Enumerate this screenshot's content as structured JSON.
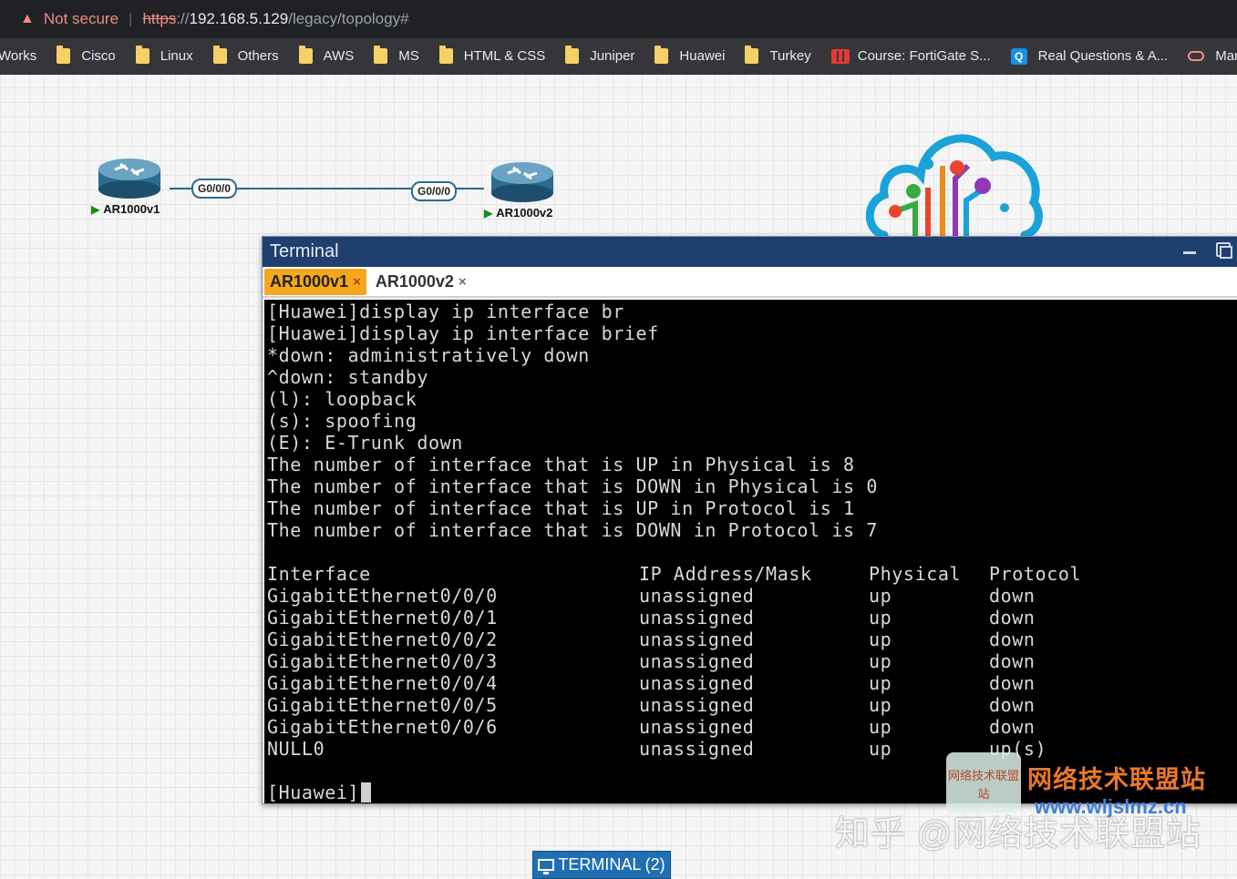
{
  "browser": {
    "security_text": "Not secure",
    "url_scheme": "https",
    "url_sep": "://",
    "url_host": "192.168.5.129",
    "url_path": "/legacy/topology#",
    "bookmarks": [
      {
        "label": "Works",
        "icon": "folder-icon"
      },
      {
        "label": "Cisco",
        "icon": "folder-icon"
      },
      {
        "label": "Linux",
        "icon": "folder-icon"
      },
      {
        "label": "Others",
        "icon": "folder-icon"
      },
      {
        "label": "AWS",
        "icon": "folder-icon"
      },
      {
        "label": "MS",
        "icon": "folder-icon"
      },
      {
        "label": "HTML & CSS",
        "icon": "folder-icon"
      },
      {
        "label": "Juniper",
        "icon": "folder-icon"
      },
      {
        "label": "Huawei",
        "icon": "folder-icon"
      },
      {
        "label": "Turkey",
        "icon": "folder-icon"
      },
      {
        "label": "Course: FortiGate S...",
        "icon": "fortinet-icon"
      },
      {
        "label": "Real Questions & A...",
        "icon": "q-app-icon"
      },
      {
        "label": "Manag",
        "icon": "manage-icon"
      }
    ]
  },
  "topology": {
    "router1": {
      "name": "AR1000v1",
      "port": "G0/0/0"
    },
    "router2": {
      "name": "AR1000v2",
      "port": "G0/0/0"
    },
    "link_color": "#2c6a8f"
  },
  "terminal": {
    "title": "Terminal",
    "tabs": [
      {
        "label": "AR1000v1",
        "active": true
      },
      {
        "label": "AR1000v2",
        "active": false
      }
    ],
    "close_glyph": "×",
    "lines": [
      "[Huawei]display ip interface br",
      "[Huawei]display ip interface brief",
      "*down: administratively down",
      "^down: standby",
      "(l): loopback",
      "(s): spoofing",
      "(E): E-Trunk down",
      "The number of interface that is UP in Physical is 8",
      "The number of interface that is DOWN in Physical is 0",
      "The number of interface that is UP in Protocol is 1",
      "The number of interface that is DOWN in Protocol is 7"
    ],
    "table_header": [
      "Interface",
      "IP Address/Mask",
      "Physical",
      "Protocol"
    ],
    "table_rows": [
      [
        "GigabitEthernet0/0/0",
        "unassigned",
        "up",
        "down"
      ],
      [
        "GigabitEthernet0/0/1",
        "unassigned",
        "up",
        "down"
      ],
      [
        "GigabitEthernet0/0/2",
        "unassigned",
        "up",
        "down"
      ],
      [
        "GigabitEthernet0/0/3",
        "unassigned",
        "up",
        "down"
      ],
      [
        "GigabitEthernet0/0/4",
        "unassigned",
        "up",
        "down"
      ],
      [
        "GigabitEthernet0/0/5",
        "unassigned",
        "up",
        "down"
      ],
      [
        "GigabitEthernet0/0/6",
        "unassigned",
        "up",
        "down"
      ],
      [
        "NULL0",
        "unassigned",
        "up",
        "up(s)"
      ]
    ],
    "prompt": "[Huawei]"
  },
  "taskbar": {
    "terminal_button": "TERMINAL (2)"
  },
  "watermark": {
    "badge": "网络技术联盟站",
    "title": "网络技术联盟站",
    "url": "www.wljslmz.cn",
    "zhihu": "知乎 @网络技术联盟站"
  },
  "colors": {
    "titlebar": "#1f3f6e",
    "active_tab": "#f4a81d",
    "taskbar_button": "#1f6fb2"
  }
}
